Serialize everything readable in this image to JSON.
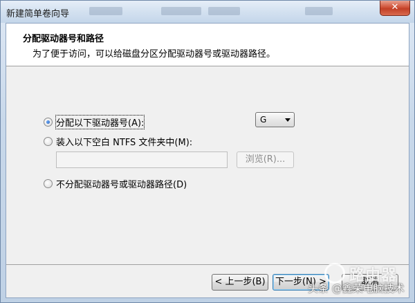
{
  "window": {
    "title": "新建简单卷向导",
    "close_glyph": "✕"
  },
  "header": {
    "title": "分配驱动器号和路径",
    "subtitle": "为了便于访问，可以给磁盘分区分配驱动器号或驱动器路径。"
  },
  "options": {
    "assign_letter_label": "分配以下驱动器号(A):",
    "mount_folder_label": "装入以下空白 NTFS 文件夹中(M):",
    "no_assign_label": "不分配驱动器号或驱动器路径(D)",
    "selected": "assign_letter"
  },
  "drive_select": {
    "value": "G"
  },
  "folder_input": {
    "value": ""
  },
  "browse_button": {
    "label": "浏览(R)..."
  },
  "footer": {
    "back_label": "< 上一步(B)",
    "next_label": "下一步(N) >",
    "cancel_label": "取消"
  },
  "watermark": {
    "logo_text": "路由器",
    "caption": "头条 @鑫荣电脑技术"
  }
}
